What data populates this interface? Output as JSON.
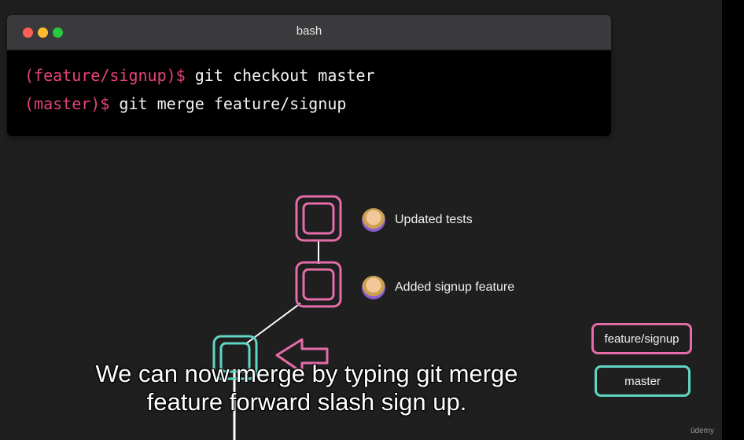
{
  "terminal": {
    "title": "bash",
    "lines": [
      {
        "prompt": "(feature/signup)$",
        "command": "git checkout master"
      },
      {
        "prompt": "(master)$",
        "command": "git merge feature/signup"
      }
    ]
  },
  "diagram": {
    "commits": [
      {
        "label": "Updated tests",
        "avatar_icon": "person-raising-hand-icon"
      },
      {
        "label": "Added signup feature",
        "avatar_icon": "person-raising-hand-icon"
      }
    ],
    "branches": {
      "feature": "feature/signup",
      "master": "master"
    },
    "colors": {
      "feature": "#e56ca8",
      "master": "#5fd6c3",
      "pointer_arrow": "#e56ca8",
      "line": "#ffffff"
    }
  },
  "caption": {
    "line1": "We can now merge by typing git merge",
    "line2": "feature forward slash sign up."
  },
  "watermark": "ūdemy"
}
